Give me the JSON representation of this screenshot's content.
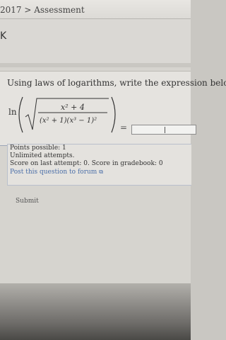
{
  "header": {
    "breadcrumb": "2017 > Assessment"
  },
  "nav": {
    "back_label": "K"
  },
  "question": {
    "prompt": "Using laws of logarithms, write the expression belo",
    "function_label": "ln",
    "numerator": "x² + 4",
    "denominator": "(x² + 1)(x³ − 1)²",
    "equals": "=",
    "answer_value": ""
  },
  "info": {
    "points_possible": "Points possible: 1",
    "attempts": "Unlimited attempts.",
    "score_line": "Score on last attempt: 0. Score in gradebook: 0",
    "forum_link": "Post this question to forum"
  },
  "actions": {
    "submit_label": "Submit"
  }
}
